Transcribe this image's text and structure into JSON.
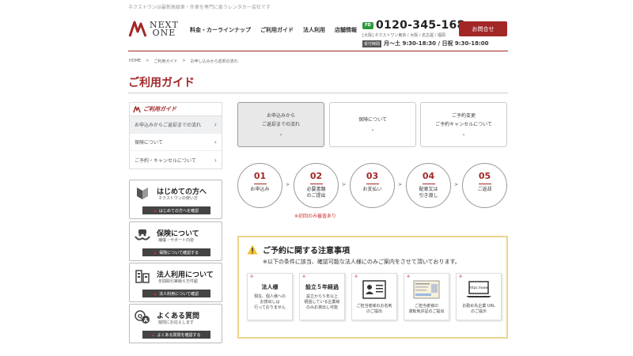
{
  "header": {
    "top_note": "ネクストワンは最新高級車・外車を専門に扱うレンタカー会社です",
    "logo": {
      "line1": "NEXT",
      "line2": "ONE"
    },
    "nav": [
      "料金・カーラインナップ",
      "ご利用ガイド",
      "法人利用",
      "店舗情報"
    ],
    "phone": {
      "free_dial_label": "FD",
      "number": "0120-345-168",
      "sub": "[大阪] ネクストワン東京 / 大阪 / 名古屋 / 福岡",
      "hours_label": "受付時間",
      "hours_text": "月〜土 9:30-18:30 / 日祝 9:30-18:00"
    },
    "contact_button": "お問合せ"
  },
  "breadcrumb": [
    "HOME",
    ">",
    "ご利用ガイド",
    ">",
    "お申し込みから返却の流れ"
  ],
  "page_title": "ご利用ガイド",
  "side_menu": {
    "heading": "ご利用ガイド",
    "items": [
      {
        "label": "お申込みからご返却までの流れ"
      },
      {
        "label": "保険について"
      },
      {
        "label": "ご予約・キャンセルについて"
      }
    ]
  },
  "side_cards": [
    {
      "title": "はじめての方へ",
      "sub": "ネクストワンの使い方",
      "button": "はじめての方へを確認"
    },
    {
      "title": "保険について",
      "sub": "補償・サポート内容",
      "button": "保険について確認する"
    },
    {
      "title": "法人利用について",
      "sub": "年間取引実績６万件超",
      "button": "法人利用について確認"
    },
    {
      "title": "よくある質問",
      "sub": "疑問にお応えします",
      "button": "よくある質問を確認する"
    }
  ],
  "tabs": [
    {
      "line1": "お申込みから",
      "line2": "ご返却までの流れ",
      "chev": "⌄"
    },
    {
      "line1": "保険について",
      "line2": "",
      "chev": "⌄"
    },
    {
      "line1": "ご予約変更",
      "line2": "ご予約キャンセルについて",
      "chev": "⌄"
    }
  ],
  "steps": [
    {
      "num": "01",
      "line1": "お申込み",
      "line2": ""
    },
    {
      "num": "02",
      "line1": "必要書類",
      "line2": "のご提出"
    },
    {
      "num": "03",
      "line1": "お支払い",
      "line2": ""
    },
    {
      "num": "04",
      "line1": "配車又は",
      "line2": "引き渡し"
    },
    {
      "num": "05",
      "line1": "ご返却",
      "line2": ""
    }
  ],
  "step_arrow": ">",
  "step_note": "※初回のみ審査あり",
  "notice": {
    "title": "ご予約に関する注意事項",
    "sub": "※以下の条件に該当、確認可能な法人様にのみご案内をさせて頂いております。",
    "cond_mark": "※",
    "conditions": [
      {
        "title": "法人様",
        "text": "現在、個人様への\nお貸出しは\n行っておりません"
      },
      {
        "title": "設立５年経過",
        "text": "設立から５年以上\n経過している企業様\nのみお貸出し可能"
      },
      {
        "title": "",
        "text": "ご担当者様のお名刺\nのご提出"
      },
      {
        "title": "",
        "text": "ご担当者様の\n運転免許証のご提出"
      },
      {
        "title": "",
        "text": "お勤め先企業 URL\nのご提示"
      }
    ],
    "url_label": "https://www."
  },
  "colors": {
    "brand": "#a22828",
    "accent_yellow": "#e9d58c",
    "free_dial": "#2d9a3e"
  }
}
